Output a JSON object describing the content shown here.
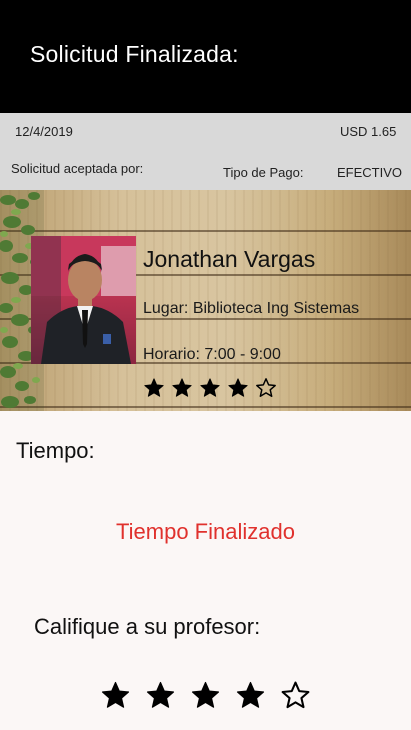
{
  "header": {
    "title": "Solicitud Finalizada:"
  },
  "info": {
    "date": "12/4/2019",
    "price": "USD 1.65",
    "accepted_by_label": "Solicitud aceptada por:",
    "payment_type_label": "Tipo de Pago:",
    "payment_type_value": "EFECTIVO"
  },
  "teacher": {
    "name": "Jonathan Vargas",
    "place": "Lugar: Biblioteca Ing Sistemas",
    "schedule": "Horario: 7:00 - 9:00",
    "rating": 4,
    "rating_max": 5
  },
  "time": {
    "label": "Tiempo:",
    "status": "Tiempo Finalizado",
    "status_color": "#e0312d"
  },
  "rate": {
    "label": "Califique a su profesor:",
    "rating": 4,
    "rating_max": 5
  }
}
